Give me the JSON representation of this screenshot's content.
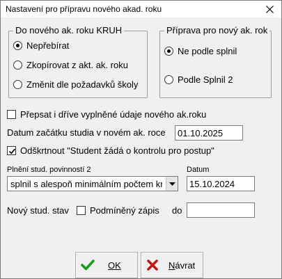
{
  "window": {
    "title": "Nastavení pro přípravu nového akad. roku"
  },
  "group_kruh": {
    "legend": "Do nového ak. roku KRUH",
    "options": [
      {
        "label": "Nepřebírat",
        "checked": true
      },
      {
        "label": "Zkopírovat z akt. ak. roku",
        "checked": false
      },
      {
        "label": "Změnit dle požadavků školy",
        "checked": false
      }
    ]
  },
  "group_priprava": {
    "legend": "Příprava pro nový ak. rok",
    "options": [
      {
        "label": "Ne podle splnil",
        "checked": true
      },
      {
        "label": "Podle Splnil 2",
        "checked": false
      }
    ]
  },
  "overwrite_checkbox": {
    "label": "Přepsat i dříve vyplněné údaje nového ak.roku",
    "checked": false
  },
  "start_date": {
    "label": "Datum začátku studia v novém ak. roce",
    "value": "01.10.2025"
  },
  "control_checkbox": {
    "label": "Odškrtnout \"Student žádá o kontrolu pro postup\"",
    "checked": true
  },
  "fulfillment": {
    "label": "Plnění stud. povinností 2",
    "selected": "splnil s alespoň minimálním počtem kreditů"
  },
  "date_field": {
    "label": "Datum",
    "value": "15.10.2024"
  },
  "new_status": {
    "label": "Nový stud. stav",
    "conditional_label": "Podmíněný zápis",
    "conditional_checked": false,
    "until_label": "do",
    "until_value": ""
  },
  "buttons": {
    "ok": "OK",
    "cancel": "Návrat"
  },
  "colors": {
    "ok_icon": "#1a9e1a",
    "cancel_icon": "#c01818",
    "dialog_bg": "#f0f0f0"
  }
}
